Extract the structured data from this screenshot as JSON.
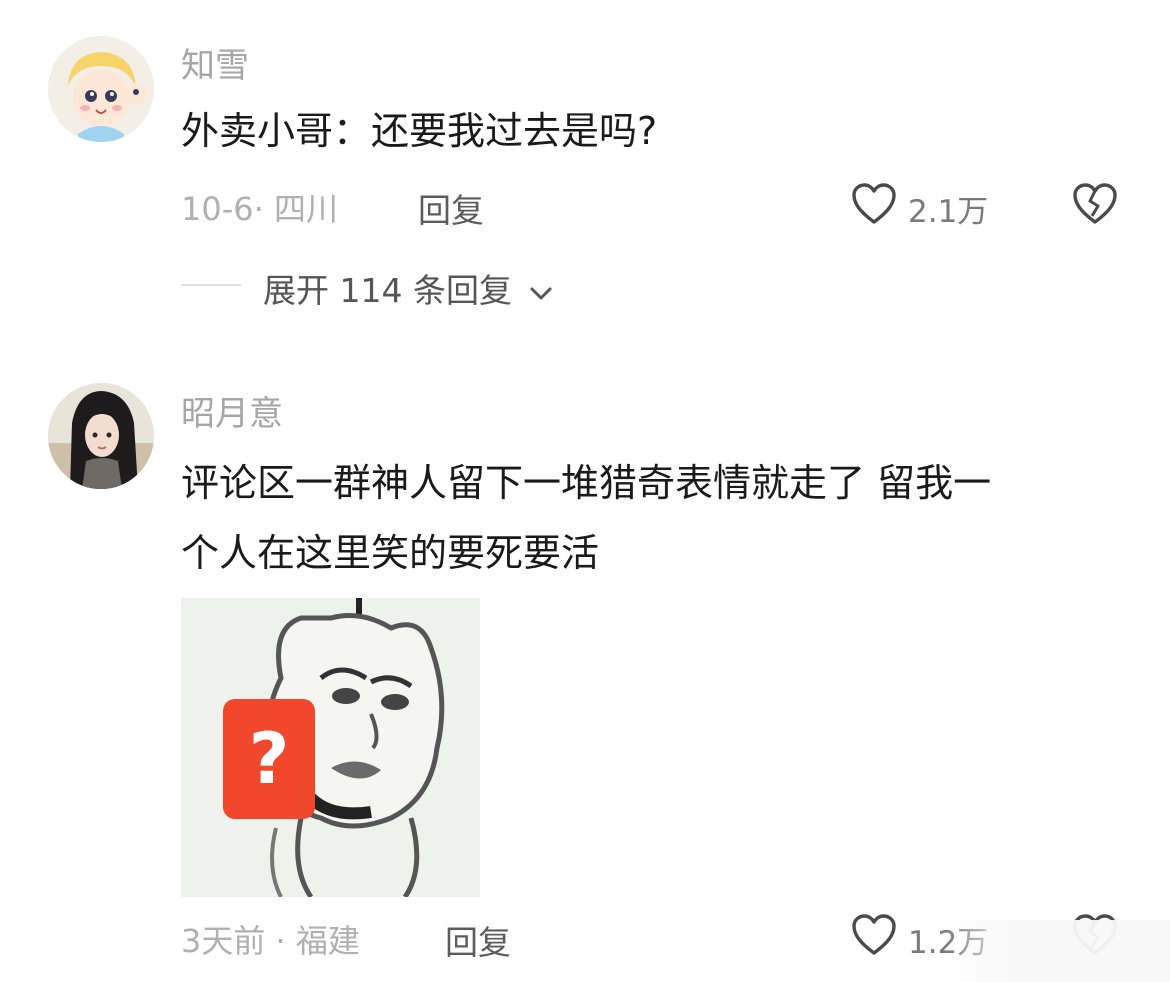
{
  "comments": [
    {
      "username": "知雪",
      "text": "外卖小哥：还要我过去是吗?",
      "meta": "10-6· 四川",
      "reply_label": "回复",
      "like_count": "2.1万",
      "expand_label": "展开 114 条回复"
    },
    {
      "username": "昭月意",
      "text_line1": "评论区一群神人留下一堆猎奇表情就走了 留我一",
      "text_line2": "个人在这里笑的要死要活",
      "sticker_badge": "?",
      "meta": "3天前 · 福建",
      "reply_label": "回复",
      "like_count": "1.2万"
    }
  ],
  "icons": {
    "like": "heart-outline-icon",
    "dislike": "broken-heart-icon",
    "expand": "chevron-down-icon"
  },
  "colors": {
    "badge": "#f0472d",
    "secondary_text": "#a6a6a6"
  }
}
